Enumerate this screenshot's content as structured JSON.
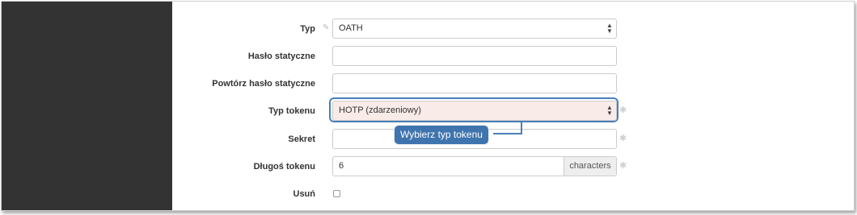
{
  "form": {
    "rows": [
      {
        "label": "Typ",
        "value": "OATH"
      },
      {
        "label": "Hasło statyczne",
        "value": ""
      },
      {
        "label": "Powtórz hasło statyczne",
        "value": ""
      },
      {
        "label": "Typ tokenu",
        "value": "HOTP (zdarzeniowy)"
      },
      {
        "label": "Sekret",
        "value": ""
      },
      {
        "label": "Długoś tokenu",
        "value": "6",
        "addon": "characters"
      },
      {
        "label": "Usuń"
      }
    ],
    "select_arrows": "▲▼"
  },
  "tooltip": {
    "text": "Wybierz typ tokenu"
  },
  "colors": {
    "sidebar": "#333333",
    "highlight": "#4a7fb8",
    "tooltip_bg": "#3f74ae",
    "highlighted_field_bg": "#f9ebe7"
  },
  "icons": {
    "edit": "edit-icon",
    "required": "asterisk-icon",
    "select": "select-arrows-icon"
  }
}
